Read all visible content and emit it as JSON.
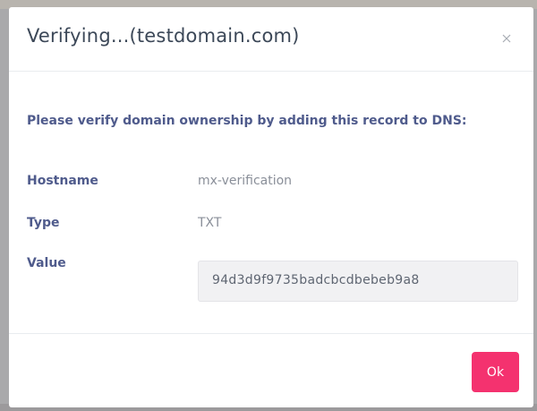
{
  "modal": {
    "title": "Verifying...(testdomain.com)",
    "instruction": "Please verify domain ownership by adding this record to DNS:",
    "fields": [
      {
        "label": "Hostname",
        "value": "mx-verification"
      },
      {
        "label": "Type",
        "value": "TXT"
      },
      {
        "label": "Value",
        "value": "94d3d9f9735badcbcdbebeb9a8"
      }
    ],
    "ok_label": "Ok",
    "close_icon": "close-icon"
  },
  "colors": {
    "backdrop": "#a9a9ab",
    "title_text": "#3c4858",
    "label_text": "#4f5b8c",
    "muted_text": "#8a8f99",
    "value_box_bg": "#f1f1f3",
    "ok_button": "#f4326f"
  }
}
